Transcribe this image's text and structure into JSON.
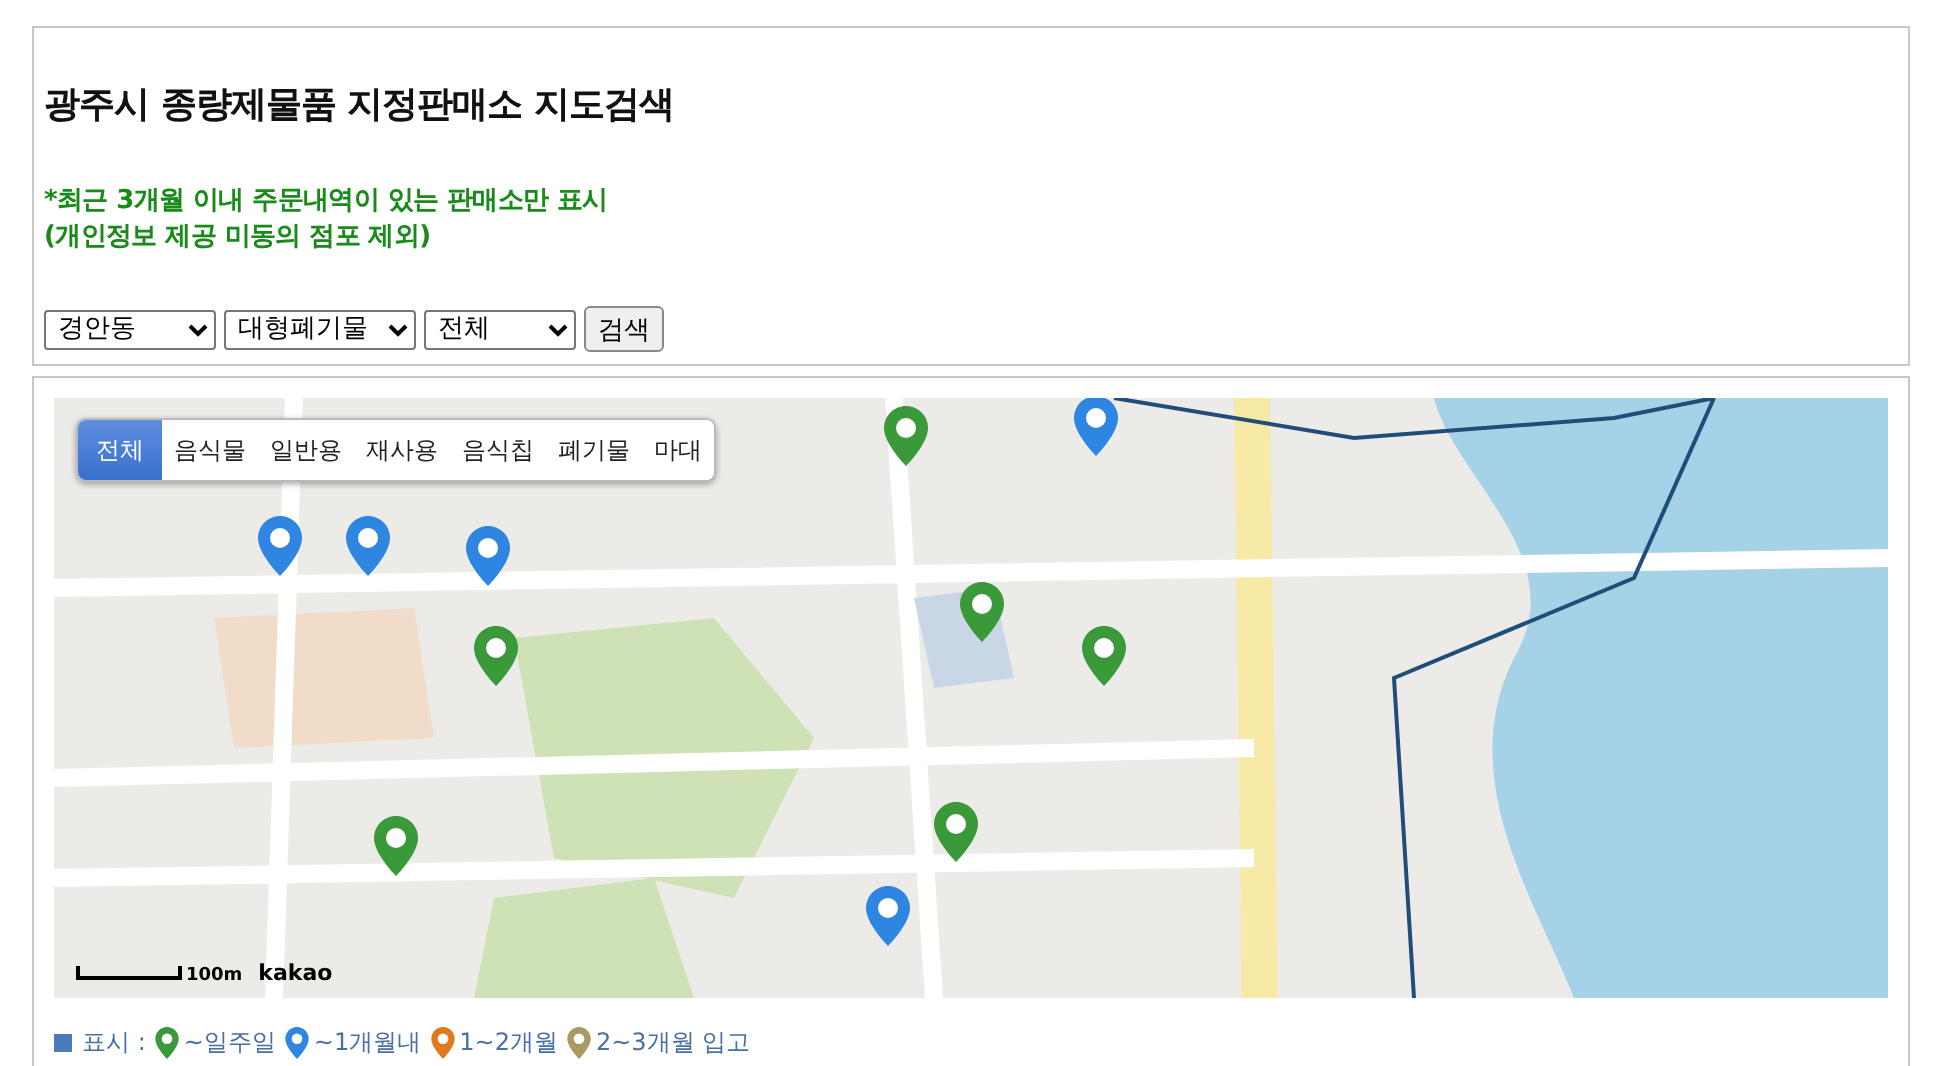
{
  "title": "광주시 종량제물품 지정판매소 지도검색",
  "notices": [
    "*최근 3개월 이내 주문내역이 있는 판매소만 표시",
    "(개인정보 제공 미동의 점포 제외)"
  ],
  "filters": [
    {
      "value": "경안동"
    },
    {
      "value": "대형폐기물"
    },
    {
      "value": "전체"
    }
  ],
  "search_button": "검색",
  "map": {
    "categories": [
      {
        "label": "전체",
        "selected": true
      },
      {
        "label": "음식물",
        "selected": false
      },
      {
        "label": "일반용",
        "selected": false
      },
      {
        "label": "재사용",
        "selected": false
      },
      {
        "label": "음식칩",
        "selected": false
      },
      {
        "label": "폐기물",
        "selected": false
      },
      {
        "label": "마대",
        "selected": false
      }
    ],
    "markers": [
      {
        "color": "#3a9a3a"
      },
      {
        "color": "#2f86e0"
      },
      {
        "color": "#2f86e0"
      },
      {
        "color": "#2f86e0"
      },
      {
        "color": "#2f86e0"
      },
      {
        "color": "#3a9a3a"
      },
      {
        "color": "#3a9a3a"
      },
      {
        "color": "#3a9a3a"
      },
      {
        "color": "#3a9a3a"
      },
      {
        "color": "#3a9a3a"
      },
      {
        "color": "#2f86e0"
      }
    ],
    "scale": "100m",
    "provider": "kakao"
  },
  "legend": {
    "label": "표시 :",
    "items": [
      {
        "color": "#3a9a3a",
        "label": "~일주일"
      },
      {
        "color": "#2f86e0",
        "label": "~1개월내"
      },
      {
        "color": "#e07a1f",
        "label": "1~2개월"
      },
      {
        "color": "#a89a62",
        "label": "2~3개월 입고"
      }
    ]
  }
}
